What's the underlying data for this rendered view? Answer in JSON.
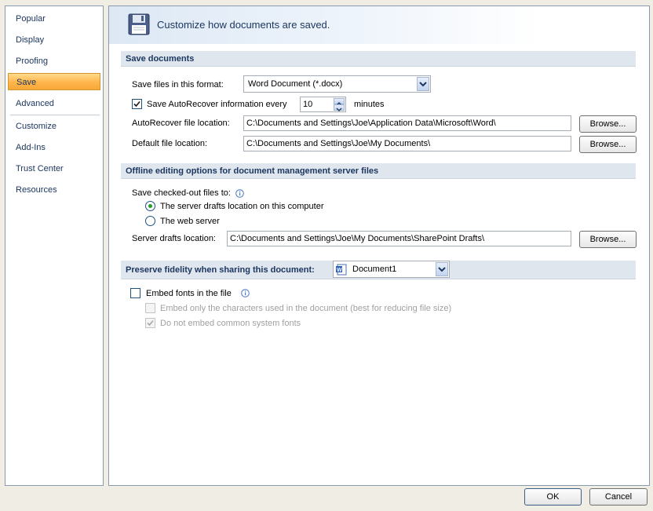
{
  "sidebar": {
    "items": [
      {
        "label": "Popular"
      },
      {
        "label": "Display"
      },
      {
        "label": "Proofing"
      },
      {
        "label": "Save"
      },
      {
        "label": "Advanced"
      },
      {
        "label": "Customize"
      },
      {
        "label": "Add-Ins"
      },
      {
        "label": "Trust Center"
      },
      {
        "label": "Resources"
      }
    ],
    "active": "Save"
  },
  "header": {
    "title": "Customize how documents are saved.",
    "icon": "floppy-disk-icon"
  },
  "save_documents": {
    "section_title": "Save documents",
    "format_label": "Save files in this format:",
    "format_value": "Word Document (*.docx)",
    "autorecover_label": "Save AutoRecover information every",
    "autorecover_checked": true,
    "autorecover_minutes": "10",
    "minutes_label": "minutes",
    "autorecover_location_label": "AutoRecover file location:",
    "autorecover_location_value": "C:\\Documents and Settings\\Joe\\Application Data\\Microsoft\\Word\\",
    "default_location_label": "Default file location:",
    "default_location_value": "C:\\Documents and Settings\\Joe\\My Documents\\",
    "browse_label": "Browse..."
  },
  "offline": {
    "section_title": "Offline editing options for document management server files",
    "save_checked_out_label": "Save checked-out files to:",
    "option_server_drafts": "The server drafts location on this computer",
    "option_web_server": "The web server",
    "selected_option": "server_drafts",
    "server_drafts_label": "Server drafts location:",
    "server_drafts_value": "C:\\Documents and Settings\\Joe\\My Documents\\SharePoint Drafts\\",
    "browse_label": "Browse..."
  },
  "fidelity": {
    "section_title": "Preserve fidelity when sharing this document:",
    "document_value": "Document1",
    "embed_fonts_label": "Embed fonts in the file",
    "embed_fonts_checked": false,
    "embed_chars_label": "Embed only the characters used in the document (best for reducing file size)",
    "embed_chars_checked": false,
    "no_common_fonts_label": "Do not embed common system fonts",
    "no_common_fonts_checked": true
  },
  "footer": {
    "ok_label": "OK",
    "cancel_label": "Cancel"
  },
  "colors": {
    "accent_nav": "#ffb54a",
    "section_band": "#e0e6ee",
    "text_blue": "#1c3760"
  }
}
